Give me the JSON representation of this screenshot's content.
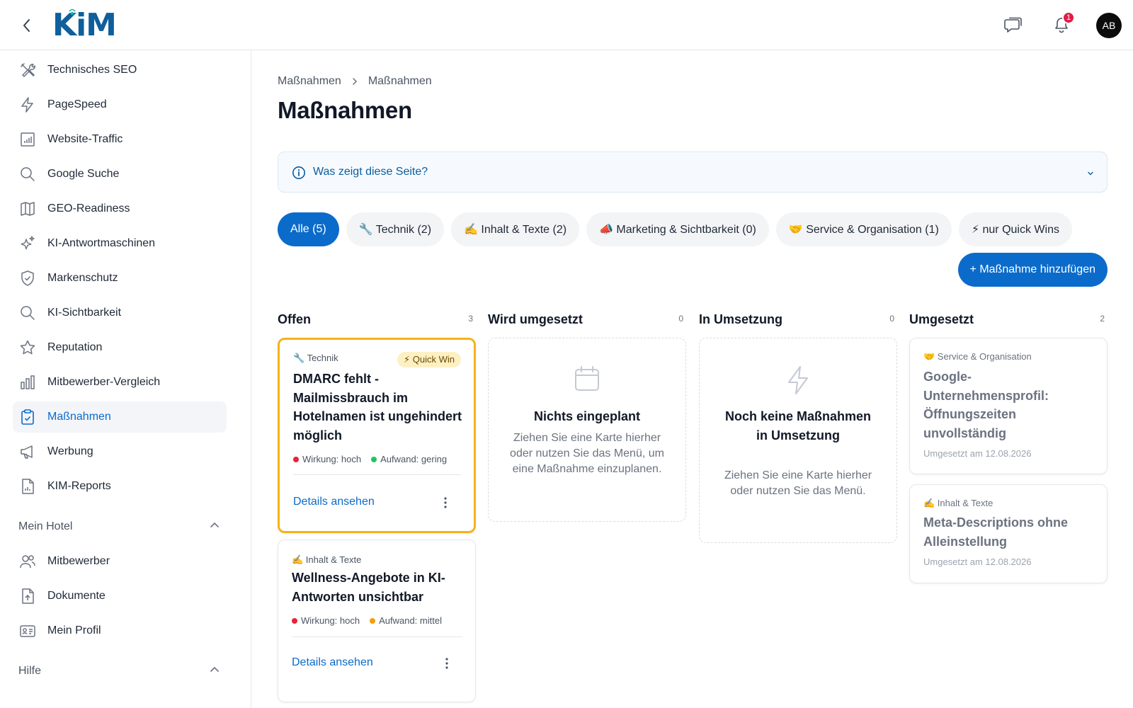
{
  "header": {
    "logo": "KiM",
    "notifications_count": "1",
    "avatar_initials": "AB"
  },
  "sidebar": {
    "items": [
      {
        "label": "Technisches SEO",
        "icon": "tools-icon"
      },
      {
        "label": "PageSpeed",
        "icon": "lightning-icon"
      },
      {
        "label": "Website-Traffic",
        "icon": "bar-chart-icon"
      },
      {
        "label": "Google Suche",
        "icon": "search-icon"
      },
      {
        "label": "GEO-Readiness",
        "icon": "map-icon"
      },
      {
        "label": "KI-Antwortmaschinen",
        "icon": "sparkles-icon"
      },
      {
        "label": "Markenschutz",
        "icon": "shield-check-icon"
      },
      {
        "label": "KI-Sichtbarkeit",
        "icon": "search-icon"
      },
      {
        "label": "Reputation",
        "icon": "star-icon"
      },
      {
        "label": "Mitbewerber-Vergleich",
        "icon": "bar-chart-icon"
      },
      {
        "label": "Maßnahmen",
        "icon": "clipboard-check-icon",
        "active": true
      },
      {
        "label": "Werbung",
        "icon": "megaphone-icon"
      },
      {
        "label": "KIM-Reports",
        "icon": "report-icon"
      }
    ],
    "section_hotel": {
      "label": "Mein Hotel",
      "items": [
        {
          "label": "Mitbewerber",
          "icon": "users-icon"
        },
        {
          "label": "Dokumente",
          "icon": "document-upload-icon"
        },
        {
          "label": "Mein Profil",
          "icon": "id-card-icon"
        }
      ]
    },
    "section_help": {
      "label": "Hilfe"
    }
  },
  "breadcrumb": [
    "Maßnahmen",
    "Maßnahmen"
  ],
  "page_title": "Maßnahmen",
  "info_box": {
    "label": "Was zeigt diese Seite?"
  },
  "filters": [
    {
      "label": "Alle (5)",
      "active": true
    },
    {
      "label": "🔧 Technik (2)"
    },
    {
      "label": "✍️ Inhalt & Texte (2)"
    },
    {
      "label": "📣 Marketing & Sichtbarkeit (0)"
    },
    {
      "label": "🤝 Service & Organisation (1)"
    },
    {
      "label": "⚡ nur Quick Wins"
    }
  ],
  "add_button": "+ Maßnahme hinzufügen",
  "columns": {
    "offen": {
      "title": "Offen",
      "count": "3",
      "cards": [
        {
          "category": "🔧 Technik",
          "badge": "⚡ Quick Win",
          "title": "DMARC fehlt - Mailmissbrauch im Hotelnamen ist ungehindert möglich",
          "impact": "Wirkung: hoch",
          "effort": "Aufwand: gering",
          "impact_color": "#e5243b",
          "effort_color": "#22c55e",
          "details": "Details ansehen"
        },
        {
          "category": "✍️ Inhalt & Texte",
          "title": "Wellness-Angebote in KI-Antworten unsichtbar",
          "impact": "Wirkung: hoch",
          "effort": "Aufwand: mittel",
          "impact_color": "#e5243b",
          "effort_color": "#f59e0b",
          "details": "Details ansehen"
        }
      ]
    },
    "wird": {
      "title": "Wird umgesetzt",
      "count": "0",
      "empty_title": "Nichts eingeplant",
      "empty_text": "Ziehen Sie eine Karte hierher oder nutzen Sie das Menü, um eine Maßnahme einzuplanen.",
      "empty_icon": "calendar-icon"
    },
    "in": {
      "title": "In Umsetzung",
      "count": "0",
      "empty_title": "Noch keine Maßnahmen in Umsetzung",
      "empty_text": "Ziehen Sie eine Karte hierher oder nutzen Sie das Menü.",
      "empty_icon": "lightning-icon"
    },
    "done": {
      "title": "Umgesetzt",
      "count": "2",
      "cards": [
        {
          "category": "🤝 Service & Organisation",
          "title": "Google-Unternehmensprofil: Öffnungszeiten unvollständig",
          "date": "Umgesetzt am 12.08.2026"
        },
        {
          "category": "✍️ Inhalt & Texte",
          "title": "Meta-Descriptions ohne Alleinstellung",
          "date": "Umgesetzt am 12.08.2026"
        }
      ]
    }
  },
  "colors": {
    "primary": "#0b6bcb",
    "logo": "#0e5f9c",
    "quick_win_border": "#f5b31a",
    "badge_red": "#e11d48"
  }
}
